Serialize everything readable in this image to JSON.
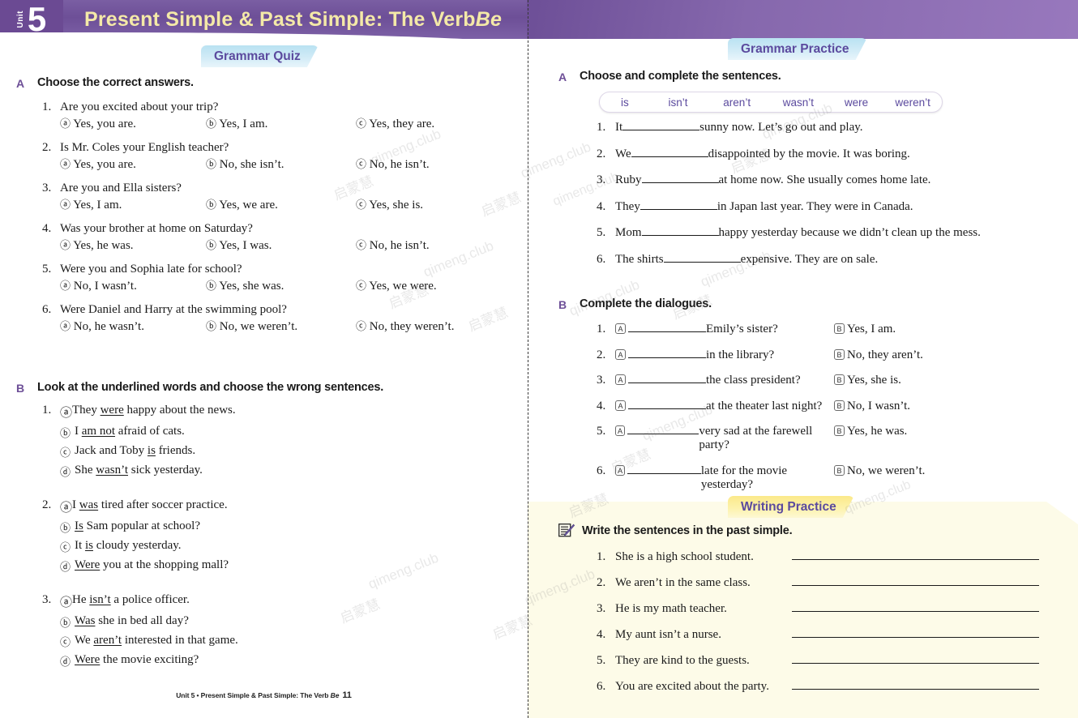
{
  "header": {
    "unit_label": "Unit",
    "unit_number": "5",
    "title_main": "Present Simple & Past Simple: The Verb ",
    "title_italic": "Be"
  },
  "tabs": {
    "grammar_quiz": "Grammar Quiz",
    "grammar_practice": "Grammar Practice",
    "writing_practice": "Writing Practice"
  },
  "left_page": {
    "section_a": {
      "letter": "A",
      "title": "Choose the correct answers.",
      "questions": [
        {
          "num": "1.",
          "prompt": "Are you excited about your trip?",
          "options": [
            "Yes, you are.",
            "Yes, I am.",
            "Yes, they are."
          ]
        },
        {
          "num": "2.",
          "prompt": "Is Mr. Coles your English teacher?",
          "options": [
            "Yes, you are.",
            "No, she isn’t.",
            "No, he isn’t."
          ]
        },
        {
          "num": "3.",
          "prompt": "Are you and Ella sisters?",
          "options": [
            "Yes, I am.",
            "Yes, we are.",
            "Yes, she is."
          ]
        },
        {
          "num": "4.",
          "prompt": "Was your brother at home on Saturday?",
          "options": [
            "Yes, he was.",
            "Yes, I was.",
            "No, he isn’t."
          ]
        },
        {
          "num": "5.",
          "prompt": "Were you and Sophia late for school?",
          "options": [
            "No, I wasn’t.",
            "Yes, she was.",
            "Yes, we were."
          ]
        },
        {
          "num": "6.",
          "prompt": "Were Daniel and Harry at the swimming pool?",
          "options": [
            "No, he wasn’t.",
            "No, we weren’t.",
            "No, they weren’t."
          ]
        }
      ]
    },
    "section_b": {
      "letter": "B",
      "title": "Look at the underlined words and choose the wrong sentences.",
      "groups": [
        {
          "num": "1.",
          "items": [
            {
              "mark": "ⓐ",
              "pre": "They ",
              "underlined": "were",
              "post": " happy about the news."
            },
            {
              "mark": "ⓑ",
              "pre": "I ",
              "underlined": "am not",
              "post": " afraid of cats."
            },
            {
              "mark": "ⓒ",
              "pre": "Jack and Toby ",
              "underlined": "is",
              "post": " friends."
            },
            {
              "mark": "ⓓ",
              "pre": "She ",
              "underlined": "wasn’t",
              "post": " sick yesterday."
            }
          ]
        },
        {
          "num": "2.",
          "items": [
            {
              "mark": "ⓐ",
              "pre": "I ",
              "underlined": "was",
              "post": " tired after soccer practice."
            },
            {
              "mark": "ⓑ",
              "pre": "",
              "underlined": "Is",
              "post": " Sam popular at school?"
            },
            {
              "mark": "ⓒ",
              "pre": "It ",
              "underlined": "is",
              "post": " cloudy yesterday."
            },
            {
              "mark": "ⓓ",
              "pre": "",
              "underlined": "Were",
              "post": " you at the shopping mall?"
            }
          ]
        },
        {
          "num": "3.",
          "items": [
            {
              "mark": "ⓐ",
              "pre": "He ",
              "underlined": "isn’t",
              "post": " a police officer."
            },
            {
              "mark": "ⓑ",
              "pre": "",
              "underlined": "Was",
              "post": " she in bed all day?"
            },
            {
              "mark": "ⓒ",
              "pre": "We ",
              "underlined": "aren’t",
              "post": " interested in that game."
            },
            {
              "mark": "ⓓ",
              "pre": "",
              "underlined": "Were",
              "post": " the movie exciting?"
            }
          ]
        }
      ]
    },
    "footer": {
      "text": "Unit 5 •  Present Simple & Past Simple: The Verb ",
      "italic": "Be",
      "page": "11"
    }
  },
  "right_page": {
    "section_a": {
      "letter": "A",
      "title": "Choose and complete the sentences.",
      "word_bank": [
        "is",
        "isn’t",
        "aren’t",
        "wasn’t",
        "were",
        "weren’t"
      ],
      "sentences": [
        {
          "num": "1.",
          "pre": "It ",
          "post": " sunny now. Let’s go out and play."
        },
        {
          "num": "2.",
          "pre": "We ",
          "post": " disappointed by the movie. It was boring."
        },
        {
          "num": "3.",
          "pre": "Ruby ",
          "post": " at home now. She usually comes home late."
        },
        {
          "num": "4.",
          "pre": "They ",
          "post": " in Japan last year. They were in Canada."
        },
        {
          "num": "5.",
          "pre": "Mom ",
          "post": " happy yesterday because we didn’t clean up the mess."
        },
        {
          "num": "6.",
          "pre": "The shirts ",
          "post": " expensive. They are on sale."
        }
      ]
    },
    "section_b": {
      "letter": "B",
      "title": "Complete the dialogues.",
      "speaker_a": "A",
      "speaker_b": "B",
      "dialogues": [
        {
          "num": "1.",
          "a_text": " Emily’s sister?",
          "b_text": "Yes, I am."
        },
        {
          "num": "2.",
          "a_text": " in the library?",
          "b_text": "No, they aren’t."
        },
        {
          "num": "3.",
          "a_text": " the class president?",
          "b_text": "Yes, she is."
        },
        {
          "num": "4.",
          "a_text": " at the theater last night?",
          "b_text": "No, I wasn’t."
        },
        {
          "num": "5.",
          "a_text": " very sad at the farewell party?",
          "b_text": "Yes, he was."
        },
        {
          "num": "6.",
          "a_text": " late for the movie yesterday?",
          "b_text": "No, we weren’t."
        }
      ]
    },
    "writing": {
      "title": "Write the sentences in the past simple.",
      "icon": "notepad-pencil-icon",
      "sentences": [
        {
          "num": "1.",
          "text": "She is a high school student."
        },
        {
          "num": "2.",
          "text": "We aren’t in the same class."
        },
        {
          "num": "3.",
          "text": "He is my math teacher."
        },
        {
          "num": "4.",
          "text": "My aunt isn’t a nurse."
        },
        {
          "num": "5.",
          "text": "They are kind to the guests."
        },
        {
          "num": "6.",
          "text": "You are excited about the party."
        }
      ]
    }
  },
  "watermark": {
    "cn": "启蒙慧",
    "en": "qimeng.club"
  },
  "colors": {
    "header_purple": "#6d4f97",
    "title_yellow": "#f4e9a8",
    "tab_blue": "#cfeaf6",
    "tab_yellow": "#fbe98a",
    "tab_text": "#5b4a9e",
    "writing_bg": "#fdfbe8"
  }
}
